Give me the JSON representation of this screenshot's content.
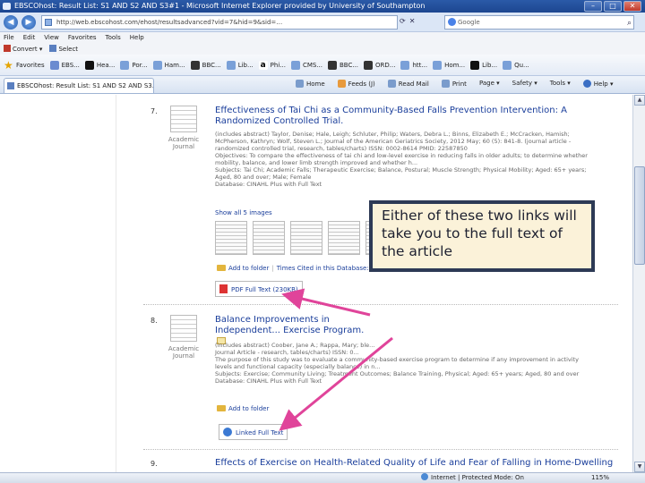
{
  "window": {
    "title": "EBSCOhost: Result List: S1 AND S2 AND S3#1 - Microsoft Internet Explorer provided by University of Southampton",
    "minimize": "–",
    "maximize": "□",
    "close": "✕"
  },
  "address_bar": {
    "url": "http://web.ebscohost.com/ehost/resultsadvanced?vid=7&hid=9&sid=…",
    "search_placeholder": "Google"
  },
  "menu": [
    "File",
    "Edit",
    "View",
    "Favorites",
    "Tools",
    "Help"
  ],
  "convert_bar": {
    "convert": "Convert",
    "select": "Select"
  },
  "favorites_bar": {
    "favorites_label": "Favorites",
    "items": [
      "EBS...",
      "Hea...",
      "Por...",
      "Ham...",
      "BBC...",
      "Lib...",
      "Phi...",
      "CMS...",
      "BBC...",
      "ORD...",
      "htt...",
      "Hom...",
      "Lib...",
      "Qu..."
    ]
  },
  "command_bar": {
    "tab_label": "EBSCOhost: Result List: S1 AND S2 AND S3...",
    "commands": [
      "Home",
      "Feeds (J)",
      "Read Mail",
      "Print",
      "Page",
      "Safety",
      "Tools",
      "Help"
    ]
  },
  "results": [
    {
      "number": "7.",
      "type_label": "Academic Journal",
      "title": "Effectiveness of Tai Chi as a Community-Based Falls Prevention Intervention: A Randomized Controlled Trial.",
      "body": "(includes abstract) Taylor, Denise; Hale, Leigh; Schluter, Philip; Waters, Debra L.; Binns, Elizabeth E.; McCracken, Hamish; McPherson, Kathryn; Wolf, Steven L.; Journal of the American Geriatrics Society, 2012 May; 60 (5): 841-8. (journal article - randomized controlled trial, research, tables/charts) ISSN: 0002-8614 PMID: 22587850\nObjectives: To compare the effectiveness of tai chi and low-level exercise in reducing falls in older adults; to determine whether mobility, balance, and lower limb strength improved and whether h...\nSubjects: Tai Chi; Academic Falls; Therapeutic Exercise; Balance, Postural; Muscle Strength; Physical Mobility; Aged: 65+ years; Aged, 80 and over; Male; Female\nDatabase: CINAHL Plus with Full Text",
      "show_images": "Show all 5 images",
      "add_to_folder": "Add to folder",
      "times_cited": "Times Cited in this Database: (1)",
      "full_text_link": "PDF Full Text (230KB)"
    },
    {
      "number": "8.",
      "type_label": "Academic Journal",
      "title": "Balance Improvements in Independent... Exercise Program.",
      "body": "(includes abstract) Coober, Jane A.; Rappa, Mary; ble...\nJournal Article - research, tables/charts) ISSN: 0...\nThe purpose of this study was to evaluate a community-based exercise program to determine if any improvement in activity levels and functional capacity (especially balance) in n...\nSubjects: Exercise; Community Living; Treatment Outcomes; Balance Training, Physical; Aged: 65+ years; Aged, 80 and over\nDatabase: CINAHL Plus with Full Text",
      "add_to_folder": "Add to folder",
      "full_text_link": "Linked Full Text"
    },
    {
      "number": "9.",
      "title": "Effects of Exercise on Health-Related Quality of Life and Fear of Falling in Home-Dwelling"
    }
  ],
  "callout": {
    "text": "Either of these two links will take you to the full text of the article",
    "border_color": "#2d3a55",
    "background_color": "#fbf2d9",
    "arrow_color": "#e0449a"
  },
  "status_bar": {
    "left": "",
    "zone": "Internet | Protected Mode: On",
    "zoom": "115%"
  }
}
